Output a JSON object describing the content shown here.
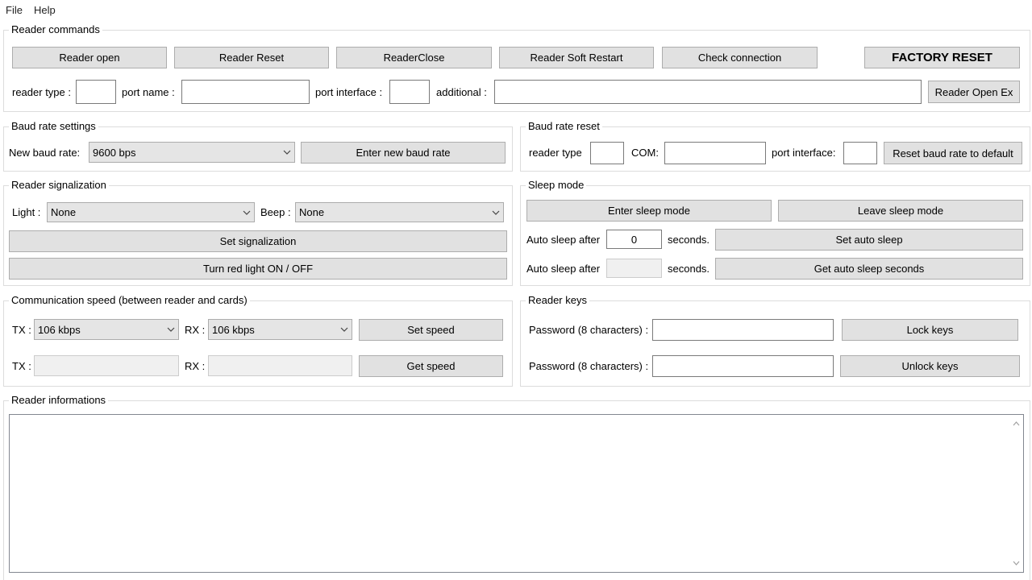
{
  "menu": {
    "file": "File",
    "help": "Help"
  },
  "reader_commands": {
    "title": "Reader commands",
    "reader_open": "Reader open",
    "reader_reset": "Reader Reset",
    "reader_close": "ReaderClose",
    "soft_restart": "Reader Soft Restart",
    "check_connection": "Check connection",
    "factory_reset": "FACTORY RESET",
    "reader_type_label": "reader type :",
    "port_name_label": "port name :",
    "port_interface_label": "port interface :",
    "additional_label": "additional :",
    "reader_open_ex": "Reader Open Ex"
  },
  "baud_settings": {
    "title": "Baud rate settings",
    "new_baud_label": "New baud rate:",
    "baud_value": "9600 bps",
    "enter_button": "Enter new baud rate"
  },
  "baud_reset": {
    "title": "Baud rate reset",
    "reader_type_label": "reader type",
    "com_label": "COM:",
    "port_interface_label": "port interface:",
    "reset_button": "Reset baud rate to default"
  },
  "signalization": {
    "title": "Reader signalization",
    "light_label": "Light :",
    "light_value": "None",
    "beep_label": "Beep :",
    "beep_value": "None",
    "set_button": "Set signalization",
    "red_light_button": "Turn red light ON / OFF"
  },
  "sleep": {
    "title": "Sleep mode",
    "enter_button": "Enter sleep mode",
    "leave_button": "Leave sleep mode",
    "auto_sleep_label": "Auto sleep after",
    "auto_sleep_value": "0",
    "seconds_label": "seconds.",
    "set_auto_button": "Set auto sleep",
    "auto_sleep_label2": "Auto sleep after",
    "seconds_label2": "seconds.",
    "get_auto_button": "Get auto sleep seconds"
  },
  "comm_speed": {
    "title": "Communication speed (between reader and cards)",
    "tx_label": "TX :",
    "tx_value": "106 kbps",
    "rx_label": "RX :",
    "rx_value": "106 kbps",
    "set_button": "Set speed",
    "tx_label2": "TX :",
    "rx_label2": "RX :",
    "get_button": "Get speed"
  },
  "reader_keys": {
    "title": "Reader keys",
    "password_label": "Password (8 characters) :",
    "lock_button": "Lock keys",
    "password_label2": "Password (8 characters) :",
    "unlock_button": "Unlock keys"
  },
  "reader_info": {
    "title": "Reader informations"
  }
}
